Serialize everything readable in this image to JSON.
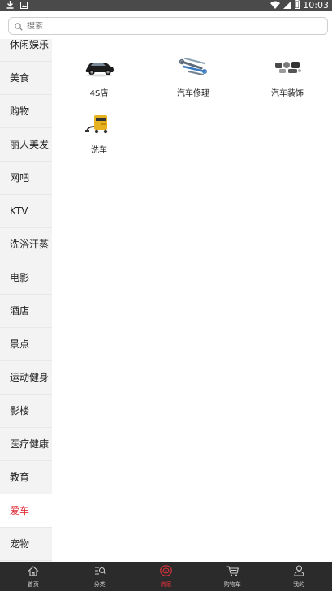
{
  "status_bar": {
    "time": "10:03"
  },
  "search": {
    "placeholder": "搜索"
  },
  "sidebar": {
    "items": [
      {
        "label": "休闲娱乐"
      },
      {
        "label": "美食"
      },
      {
        "label": "购物"
      },
      {
        "label": "丽人美发"
      },
      {
        "label": "网吧"
      },
      {
        "label": "KTV"
      },
      {
        "label": "洗浴汗蒸"
      },
      {
        "label": "电影"
      },
      {
        "label": "酒店"
      },
      {
        "label": "景点"
      },
      {
        "label": "运动健身"
      },
      {
        "label": "影楼"
      },
      {
        "label": "医疗健康"
      },
      {
        "label": "教育"
      },
      {
        "label": "爱车",
        "active": true
      },
      {
        "label": "宠物"
      }
    ]
  },
  "categories": [
    {
      "label": "4S店",
      "icon": "car-icon"
    },
    {
      "label": "汽车修理",
      "icon": "car-repair-tools-icon"
    },
    {
      "label": "汽车装饰",
      "icon": "car-accessories-icon"
    },
    {
      "label": "洗车",
      "icon": "car-wash-icon"
    }
  ],
  "tabs": [
    {
      "label": "首页",
      "icon": "home-icon"
    },
    {
      "label": "分类",
      "icon": "category-icon"
    },
    {
      "label": "商家",
      "icon": "merchant-icon",
      "active": true
    },
    {
      "label": "购物车",
      "icon": "cart-icon"
    },
    {
      "label": "我的",
      "icon": "user-icon"
    }
  ],
  "colors": {
    "accent": "#e0323c",
    "tabbar_bg": "#2b2b2b",
    "status_bg": "#4a4a4a",
    "sidebar_bg": "#f3f3f3"
  }
}
